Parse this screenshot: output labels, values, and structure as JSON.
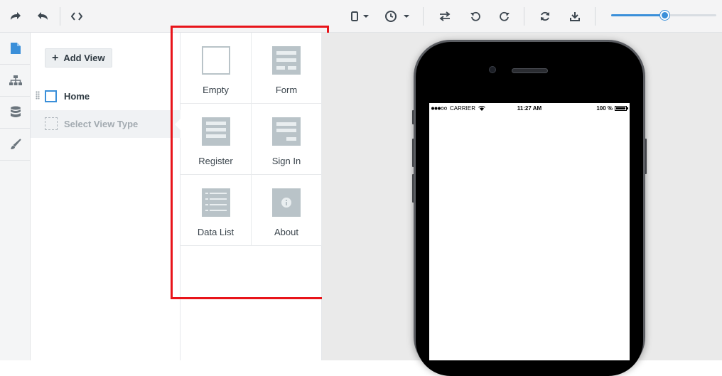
{
  "toolbar": {
    "redo_icon": "redo-icon",
    "undo_icon": "undo-icon",
    "code_icon": "code-icon",
    "device_icon": "mobile-device-icon",
    "clock_icon": "clock-icon",
    "swap_icon": "swap-icon",
    "rotate_left_icon": "rotate-left-icon",
    "rotate_right_icon": "rotate-right-icon",
    "refresh_icon": "refresh-icon",
    "download_icon": "download-icon",
    "zoom_level": 0.51
  },
  "sidebar_icons": [
    "page-icon",
    "sitemap-icon",
    "database-icon",
    "brush-icon"
  ],
  "views_panel": {
    "add_view_label": "Add View",
    "views": [
      {
        "label": "Home"
      },
      {
        "label": "Select View Type"
      }
    ]
  },
  "view_types": [
    {
      "label": "Empty"
    },
    {
      "label": "Form"
    },
    {
      "label": "Register"
    },
    {
      "label": "Sign In"
    },
    {
      "label": "Data List"
    },
    {
      "label": "About"
    }
  ],
  "phone": {
    "carrier": "CARRIER",
    "time": "11:27 AM",
    "battery": "100 %"
  },
  "colors": {
    "accent": "#3a8fd9",
    "highlight": "#e8141a",
    "thumb": "#b9c3c8"
  }
}
